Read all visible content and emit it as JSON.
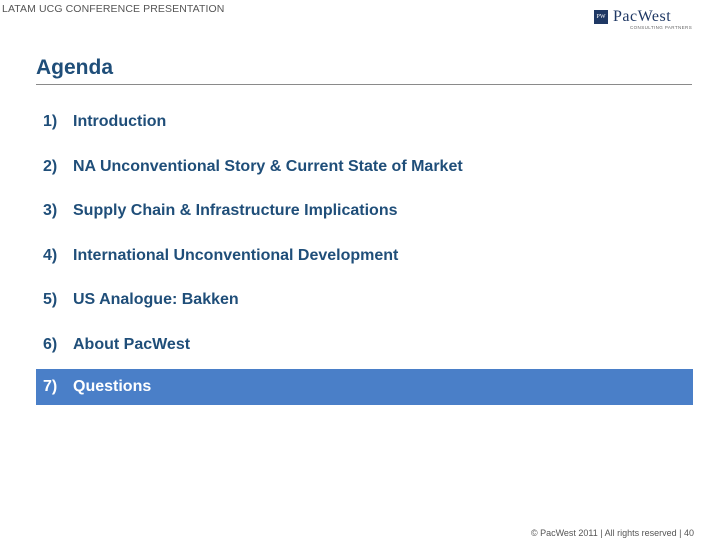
{
  "header": {
    "presentation_label": "LATAM UCG CONFERENCE PRESENTATION",
    "logo": {
      "mark": "PW",
      "wordmark": "PacWest",
      "tagline": "CONSULTING PARTNERS",
      "brand_color": "#1f3864"
    }
  },
  "slide": {
    "title": "Agenda",
    "items": [
      {
        "number": "1)",
        "label": "Introduction"
      },
      {
        "number": "2)",
        "label": "NA Unconventional Story & Current State of Market"
      },
      {
        "number": "3)",
        "label": "Supply Chain & Infrastructure Implications"
      },
      {
        "number": "4)",
        "label": "International Unconventional Development"
      },
      {
        "number": "5)",
        "label": "US Analogue: Bakken"
      },
      {
        "number": "6)",
        "label": "About PacWest"
      },
      {
        "number": "7)",
        "label": "Questions"
      }
    ],
    "highlight_color": "#4a7fc8",
    "text_color": "#1f4e79"
  },
  "footer": {
    "text": "© PacWest 2011 | All rights reserved | 40"
  }
}
